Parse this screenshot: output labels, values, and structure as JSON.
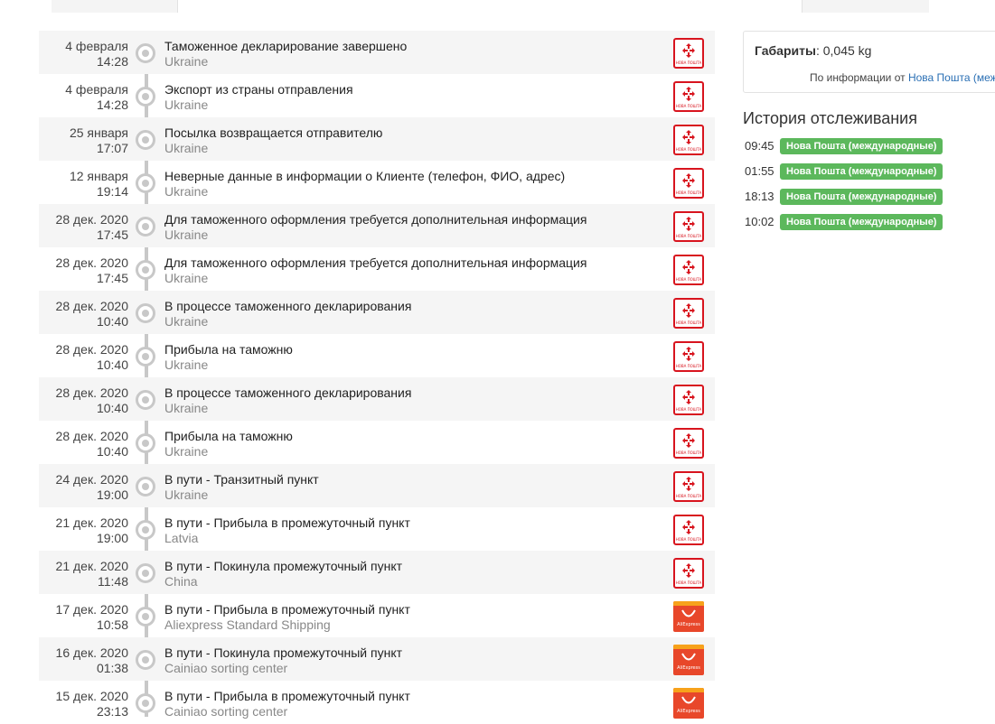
{
  "events": [
    {
      "date": "4 февраля",
      "time": "14:28",
      "title": "Таможенное декларирование завершено",
      "location": "Ukraine",
      "carrier": "nova-poshta-logo"
    },
    {
      "date": "4 февраля",
      "time": "14:28",
      "title": "Экспорт из страны отправления",
      "location": "Ukraine",
      "carrier": "nova-poshta-logo"
    },
    {
      "date": "25 января",
      "time": "17:07",
      "title": "Посылка возвращается отправителю",
      "location": "Ukraine",
      "carrier": "nova-poshta-logo"
    },
    {
      "date": "12 января",
      "time": "19:14",
      "title": "Неверные данные в информации о Клиенте (телефон, ФИО, адрес)",
      "location": "Ukraine",
      "carrier": "nova-poshta-logo"
    },
    {
      "date": "28 дек. 2020",
      "time": "17:45",
      "title": "Для таможенного оформления требуется дополнительная информация",
      "location": "Ukraine",
      "carrier": "nova-poshta-logo"
    },
    {
      "date": "28 дек. 2020",
      "time": "17:45",
      "title": "Для таможенного оформления требуется дополнительная информация",
      "location": "Ukraine",
      "carrier": "nova-poshta-logo"
    },
    {
      "date": "28 дек. 2020",
      "time": "10:40",
      "title": "В процессе таможенного декларирования",
      "location": "Ukraine",
      "carrier": "nova-poshta-logo"
    },
    {
      "date": "28 дек. 2020",
      "time": "10:40",
      "title": "Прибыла на таможню",
      "location": "Ukraine",
      "carrier": "nova-poshta-logo"
    },
    {
      "date": "28 дек. 2020",
      "time": "10:40",
      "title": "В процессе таможенного декларирования",
      "location": "Ukraine",
      "carrier": "nova-poshta-logo"
    },
    {
      "date": "28 дек. 2020",
      "time": "10:40",
      "title": "Прибыла на таможню",
      "location": "Ukraine",
      "carrier": "nova-poshta-logo"
    },
    {
      "date": "24 дек. 2020",
      "time": "19:00",
      "title": "В пути - Транзитный пункт",
      "location": "Ukraine",
      "carrier": "nova-poshta-logo"
    },
    {
      "date": "21 дек. 2020",
      "time": "19:00",
      "title": "В пути - Прибыла в промежуточный пункт",
      "location": "Latvia",
      "carrier": "nova-poshta-logo"
    },
    {
      "date": "21 дек. 2020",
      "time": "11:48",
      "title": "В пути - Покинула промежуточный пункт",
      "location": "China",
      "carrier": "nova-poshta-logo"
    },
    {
      "date": "17 дек. 2020",
      "time": "10:58",
      "title": "В пути - Прибыла в промежуточный пункт",
      "location": "Aliexpress Standard Shipping",
      "carrier": "aliexpress-logo"
    },
    {
      "date": "16 дек. 2020",
      "time": "01:38",
      "title": "В пути - Покинула промежуточный пункт",
      "location": "Cainiao sorting center",
      "carrier": "aliexpress-logo"
    },
    {
      "date": "15 дек. 2020",
      "time": "23:13",
      "title": "В пути - Прибыла в промежуточный пункт",
      "location": "Cainiao sorting center",
      "carrier": "aliexpress-logo"
    }
  ],
  "logos": {
    "nova_poshta_text": "НОВА ПОШТА",
    "aliexpress_text": "AliExpress"
  },
  "info_box": {
    "dims_label": "Габариты",
    "dims_value": ": 0,045 kg",
    "source_prefix": "По информации от ",
    "source_link": "Нова Пошта (меж"
  },
  "history": {
    "title": "История отслеживания",
    "items": [
      {
        "time": "09:45",
        "label": "Нова Пошта (международные)"
      },
      {
        "time": "01:55",
        "label": "Нова Пошта (международные)"
      },
      {
        "time": "18:13",
        "label": "Нова Пошта (международные)"
      },
      {
        "time": "10:02",
        "label": "Нова Пошта (международные)"
      }
    ]
  },
  "colors": {
    "nova_poshta_red": "#d8141e",
    "aliexpress_orange": "#e8472a",
    "badge_green": "#5cb85c",
    "link_blue": "#2a6fb4"
  }
}
